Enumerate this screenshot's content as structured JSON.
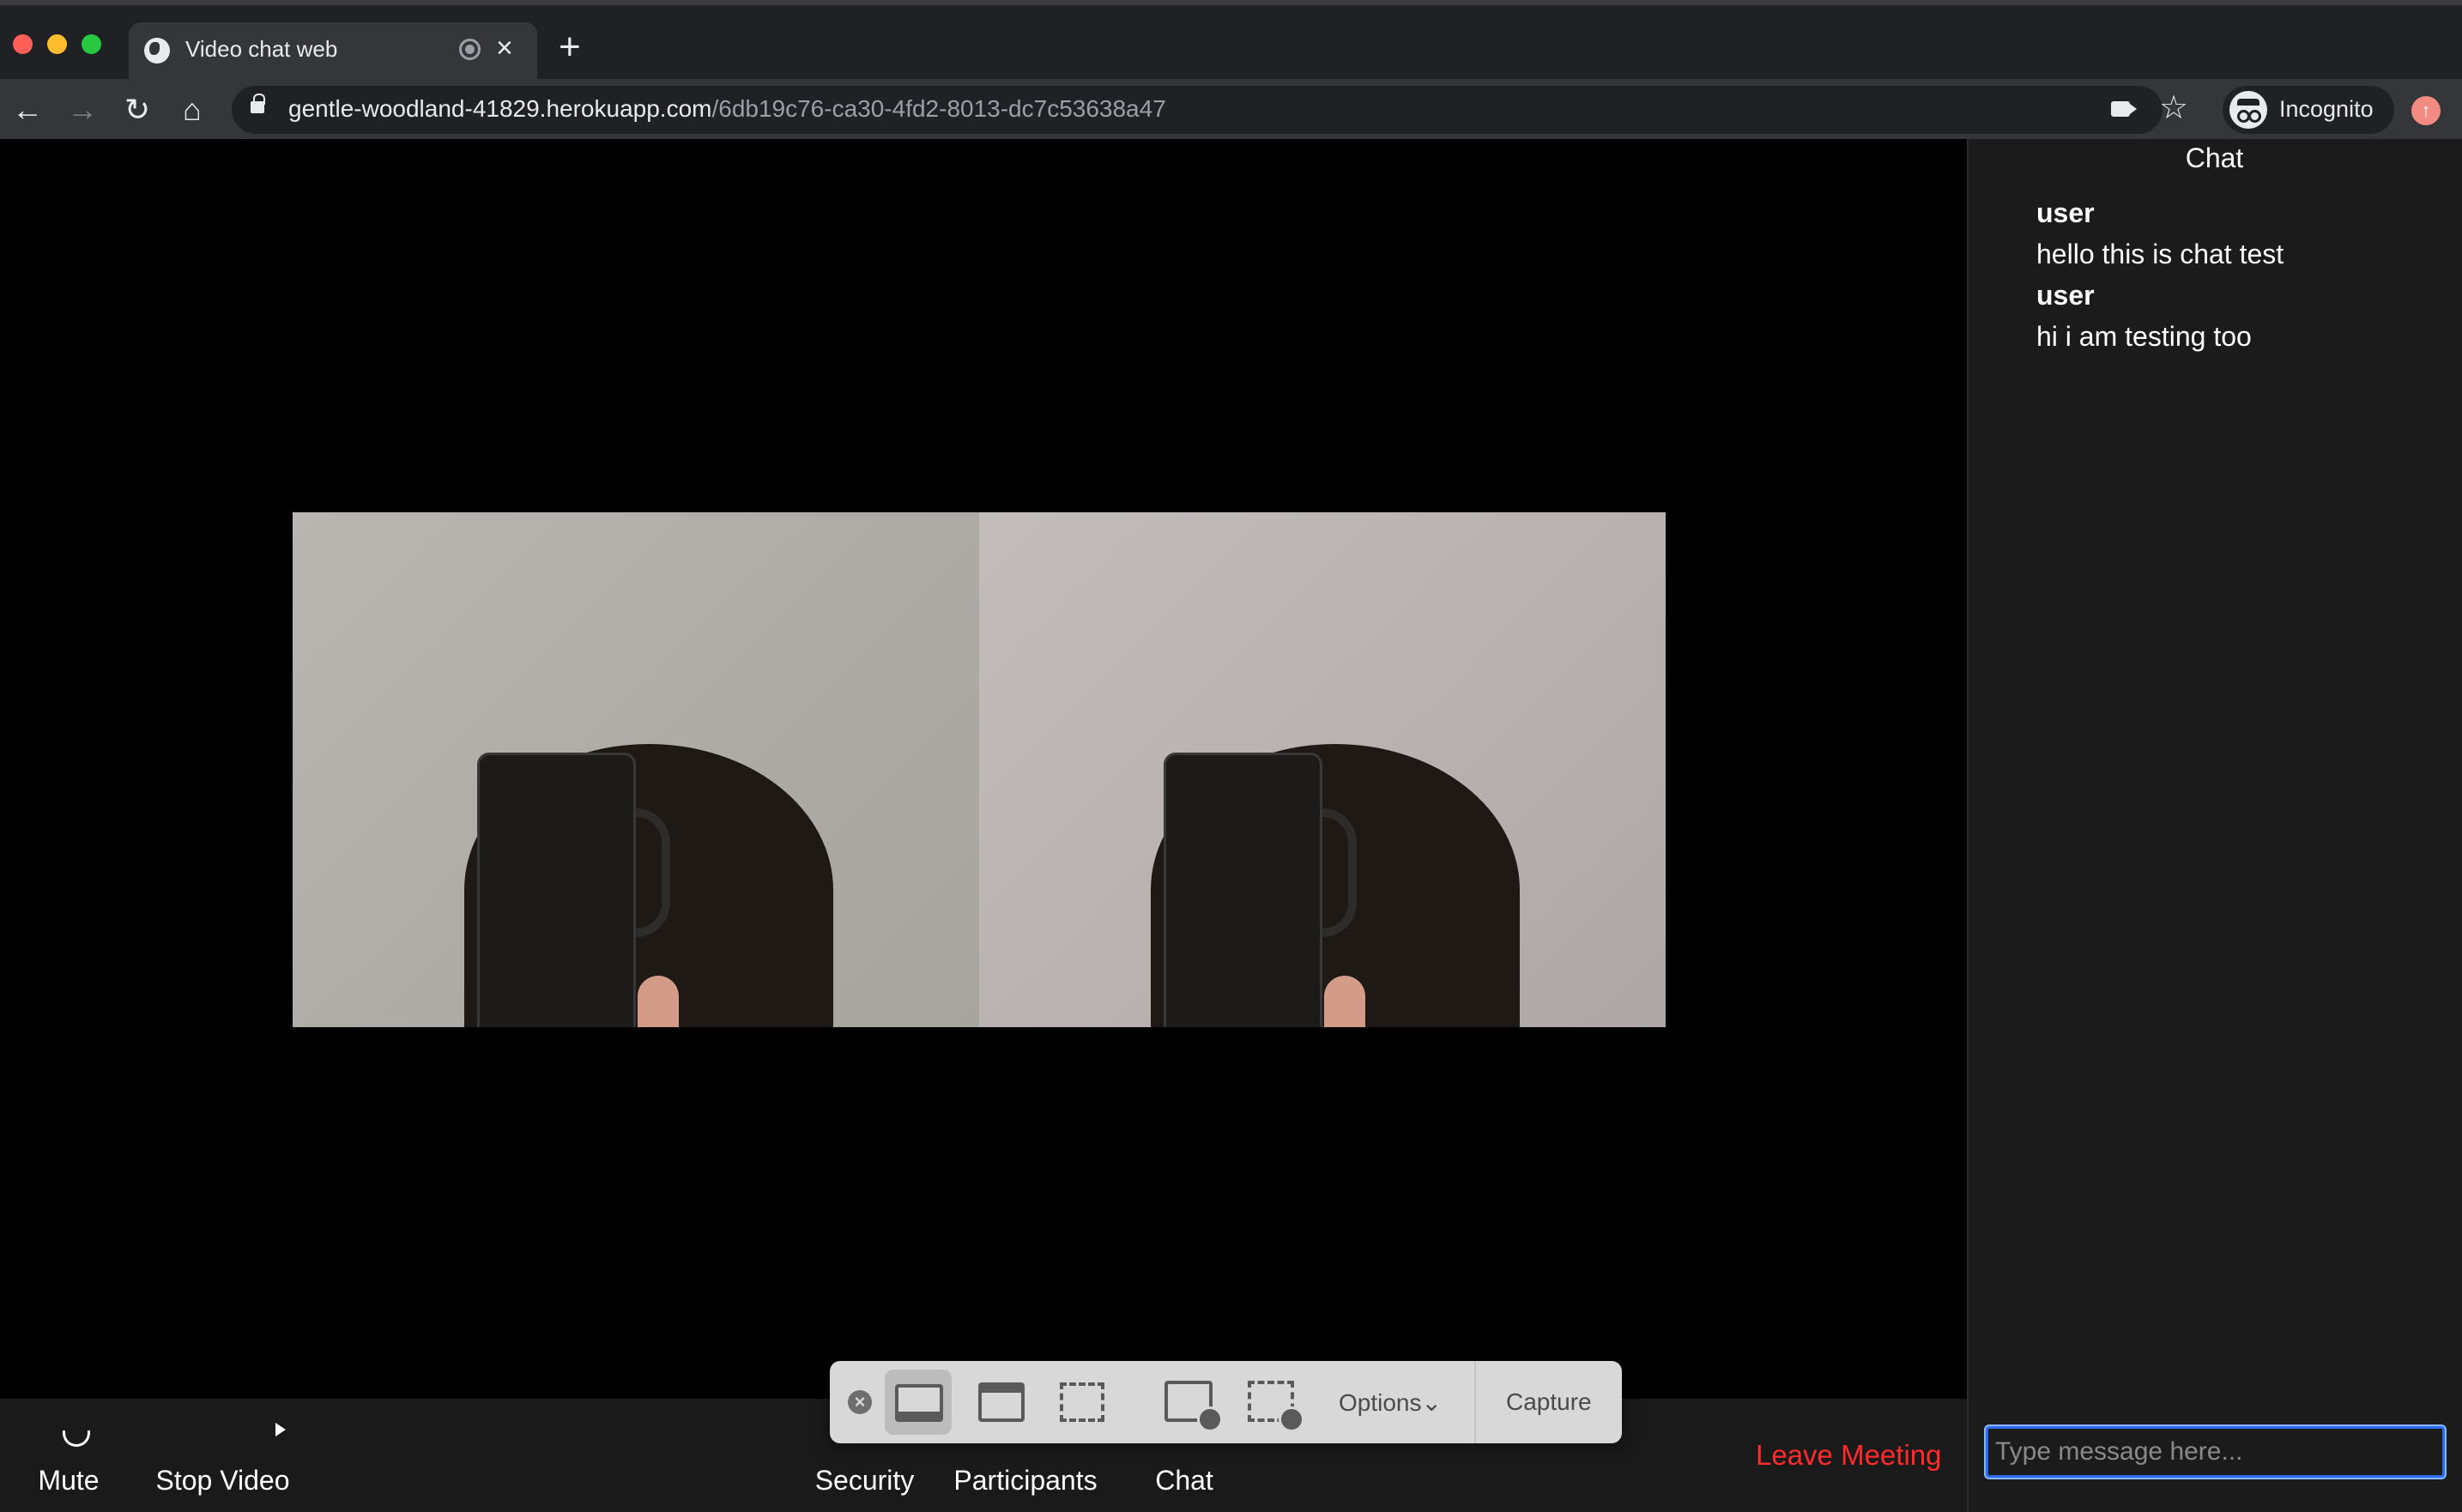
{
  "browser": {
    "tab_title": "Video chat web",
    "url_host": "gentle-woodland-41829.herokuapp.com",
    "url_path": "/6db19c76-ca30-4fd2-8013-dc7c53638a47",
    "profile_label": "Incognito",
    "icons": [
      "globe-favicon",
      "recording-indicator-icon",
      "close-tab-icon",
      "new-tab-icon",
      "back-icon",
      "forward-icon",
      "reload-icon",
      "home-icon",
      "lock-icon",
      "camera-in-use-icon",
      "bookmark-star-icon",
      "incognito-icon",
      "update-icon"
    ]
  },
  "controls": {
    "mute_label": "Mute",
    "stop_video_label": "Stop Video",
    "security_label": "Security",
    "participants_label": "Participants",
    "chat_label": "Chat",
    "leave_label": "Leave Meeting"
  },
  "capture_toolbar": {
    "options_label": "Options⌄",
    "capture_label": "Capture",
    "tools": [
      "capture-entire-screen",
      "capture-selected-window",
      "capture-selected-portion",
      "record-entire-screen",
      "record-selected-portion"
    ],
    "selected_tool": "capture-entire-screen"
  },
  "chat": {
    "title": "Chat",
    "messages": [
      {
        "user": "user",
        "text": "hello this is chat test"
      },
      {
        "user": "user",
        "text": "hi i am testing too"
      }
    ],
    "input_placeholder": "Type message here..."
  },
  "colors": {
    "leave_meeting": "#ff2a2a",
    "chat_input_focus": "#2b6cf0",
    "chrome_bg": "#202124"
  }
}
